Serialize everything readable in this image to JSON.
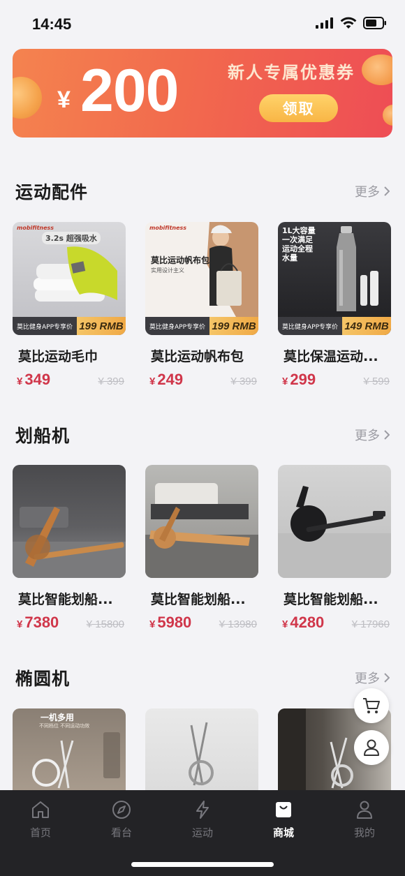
{
  "status_bar": {
    "time": "14:45"
  },
  "banner": {
    "currency_symbol": "¥",
    "amount": "200",
    "title": "新人专属优惠券",
    "claim_button": "领取"
  },
  "sections": [
    {
      "title": "运动配件",
      "more_label": "更多",
      "products": [
        {
          "name": "莫比运动毛巾",
          "price": "349",
          "original_price": "¥ 399",
          "promo_tag": "莫比健身APP专享价",
          "promo_price": "199 RMB",
          "thumb_brand": "mobifitness",
          "thumb_caption": "3.2s 超强吸水"
        },
        {
          "name": "莫比运动帆布包",
          "price": "249",
          "original_price": "¥ 399",
          "promo_tag": "莫比健身APP专享价",
          "promo_price": "199 RMB",
          "thumb_brand": "mobifitness",
          "thumb_caption": "莫比运动帆布包",
          "thumb_sub": "实用设计主义"
        },
        {
          "name": "莫比保温运动...",
          "price": "299",
          "original_price": "¥ 599",
          "promo_tag": "莫比健身APP专享价",
          "promo_price": "149 RMB",
          "thumb_caption": "1L大容量 一次满足运动全程水量"
        }
      ]
    },
    {
      "title": "划船机",
      "more_label": "更多",
      "products": [
        {
          "name": "莫比智能划船...",
          "price": "7380",
          "original_price": "¥ 15800"
        },
        {
          "name": "莫比智能划船...",
          "price": "5980",
          "original_price": "¥ 13980"
        },
        {
          "name": "莫比智能划船...",
          "price": "4280",
          "original_price": "¥ 17960"
        }
      ]
    },
    {
      "title": "椭圆机",
      "more_label": "更多",
      "products": [
        {
          "thumb_caption": "一机多用",
          "thumb_sub": "不同档位 不同运动功效"
        },
        {},
        {}
      ]
    }
  ],
  "tabbar": {
    "items": [
      {
        "label": "首页",
        "icon": "home-icon",
        "active": false
      },
      {
        "label": "看台",
        "icon": "compass-icon",
        "active": false
      },
      {
        "label": "运动",
        "icon": "lightning-icon",
        "active": false
      },
      {
        "label": "商城",
        "icon": "shopping-bag-icon",
        "active": true
      },
      {
        "label": "我的",
        "icon": "person-icon",
        "active": false
      }
    ]
  },
  "colors": {
    "price_red": "#d0364a",
    "banner_start": "#f4834f",
    "banner_end": "#ee4d55",
    "tabbar_bg": "#232326"
  }
}
